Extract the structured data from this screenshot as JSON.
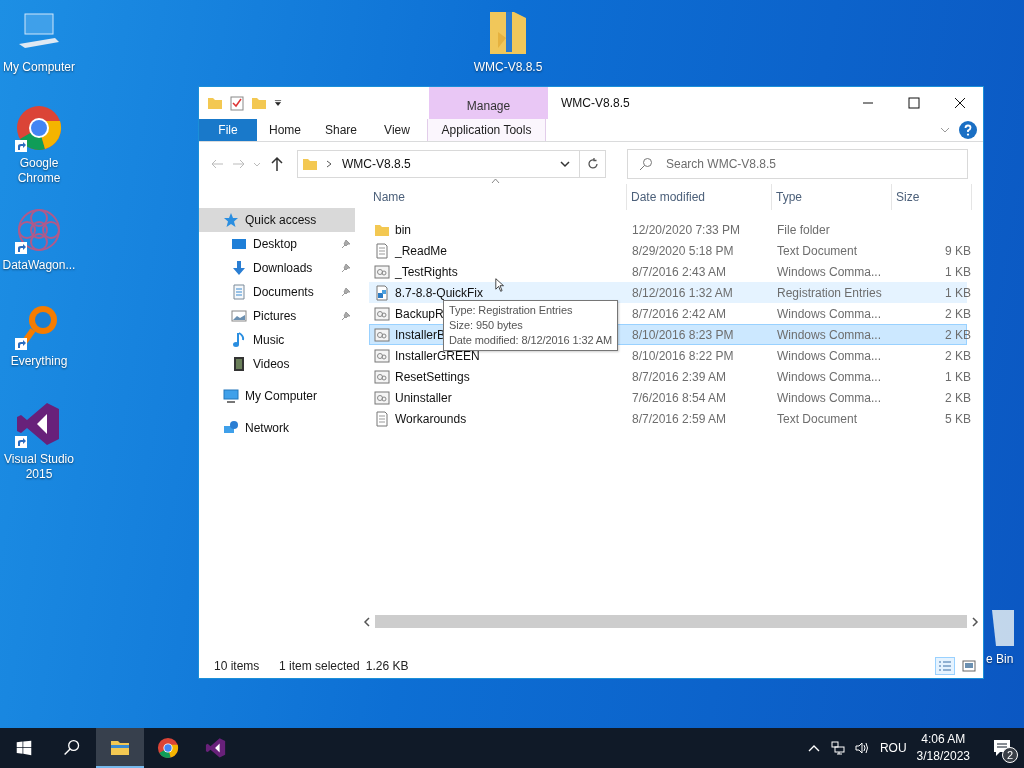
{
  "desktop_icons": [
    {
      "label": "My Computer",
      "kind": "computer",
      "shortcut": false
    },
    {
      "label": "Google\nChrome",
      "kind": "chrome",
      "shortcut": true
    },
    {
      "label": "DataWagon...",
      "kind": "flower",
      "shortcut": true
    },
    {
      "label": "Everything",
      "kind": "magnifier",
      "shortcut": true
    },
    {
      "label": "Visual Studio\n2015",
      "kind": "vs",
      "shortcut": true
    },
    {
      "label": "WMC-V8.8.5",
      "kind": "zipfolder",
      "shortcut": false
    },
    {
      "label": "e Bin",
      "kind": "bin",
      "shortcut": false
    }
  ],
  "window": {
    "title": "WMC-V8.8.5",
    "context_group": "Manage",
    "ribbon_tabs": [
      {
        "label": "File",
        "kind": "file"
      },
      {
        "label": "Home",
        "kind": "plain"
      },
      {
        "label": "Share",
        "kind": "plain"
      },
      {
        "label": "View",
        "kind": "plain"
      },
      {
        "label": "Application Tools",
        "kind": "context"
      }
    ],
    "address": {
      "path": "WMC-V8.8.5"
    },
    "search": {
      "placeholder": "Search WMC-V8.8.5"
    },
    "nav": [
      {
        "label": "Quick access",
        "kind": "star",
        "selected": true,
        "pinned": false,
        "children": [
          {
            "label": "Desktop",
            "kind": "desktop",
            "selected": false,
            "pinned": true
          },
          {
            "label": "Downloads",
            "kind": "download",
            "selected": false,
            "pinned": true
          },
          {
            "label": "Documents",
            "kind": "document",
            "selected": false,
            "pinned": true
          },
          {
            "label": "Pictures",
            "kind": "pictures",
            "selected": false,
            "pinned": true
          },
          {
            "label": "Music",
            "kind": "music",
            "selected": false,
            "pinned": false
          },
          {
            "label": "Videos",
            "kind": "videos",
            "selected": false,
            "pinned": false
          }
        ]
      },
      {
        "label": "My Computer",
        "kind": "computer",
        "selected": false,
        "pinned": false
      },
      {
        "label": "Network",
        "kind": "network",
        "selected": false,
        "pinned": false
      }
    ],
    "columns": [
      "Name",
      "Date modified",
      "Type",
      "Size"
    ],
    "rows": [
      {
        "name": "bin",
        "date": "12/20/2020 7:33 PM",
        "type": "File folder",
        "size": "",
        "kind": "folder",
        "selected": false,
        "hovered": false
      },
      {
        "name": "_ReadMe",
        "date": "8/29/2020 5:18 PM",
        "type": "Text Document",
        "size": "9 KB",
        "kind": "text",
        "selected": false,
        "hovered": false
      },
      {
        "name": "_TestRights",
        "date": "8/7/2016 2:43 AM",
        "type": "Windows Comma...",
        "size": "1 KB",
        "kind": "cmd",
        "selected": false,
        "hovered": false
      },
      {
        "name": "8.7-8.8-QuickFix",
        "date": "8/12/2016 1:32 AM",
        "type": "Registration Entries",
        "size": "1 KB",
        "kind": "reg",
        "selected": false,
        "hovered": true
      },
      {
        "name": "BackupR",
        "date": "8/7/2016 2:42 AM",
        "type": "Windows Comma...",
        "size": "2 KB",
        "kind": "cmd",
        "selected": false,
        "hovered": false
      },
      {
        "name": "InstallerB",
        "date": "8/10/2016 8:23 PM",
        "type": "Windows Comma...",
        "size": "2 KB",
        "kind": "cmd",
        "selected": true,
        "hovered": false
      },
      {
        "name": "InstallerGREEN",
        "date": "8/10/2016 8:22 PM",
        "type": "Windows Comma...",
        "size": "2 KB",
        "kind": "cmd",
        "selected": false,
        "hovered": false
      },
      {
        "name": "ResetSettings",
        "date": "8/7/2016 2:39 AM",
        "type": "Windows Comma...",
        "size": "1 KB",
        "kind": "cmd",
        "selected": false,
        "hovered": false
      },
      {
        "name": "Uninstaller",
        "date": "7/6/2016 8:54 AM",
        "type": "Windows Comma...",
        "size": "2 KB",
        "kind": "cmd",
        "selected": false,
        "hovered": false
      },
      {
        "name": "Workarounds",
        "date": "8/7/2016 2:59 AM",
        "type": "Text Document",
        "size": "5 KB",
        "kind": "text",
        "selected": false,
        "hovered": false
      }
    ],
    "tooltip": [
      "Type: Registration Entries",
      "Size: 950 bytes",
      "Date modified: 8/12/2016 1:32 AM"
    ],
    "status_bar": {
      "count": "10 items",
      "selection": "1 item selected",
      "size": "1.26 KB"
    }
  },
  "taskbar": {
    "apps": [
      {
        "kind": "explorer",
        "active": true
      },
      {
        "kind": "chrome",
        "active": false
      },
      {
        "kind": "vs",
        "active": false
      }
    ],
    "language": "ROU",
    "time": "4:06 AM",
    "date": "3/18/2023",
    "notifications": "2"
  }
}
